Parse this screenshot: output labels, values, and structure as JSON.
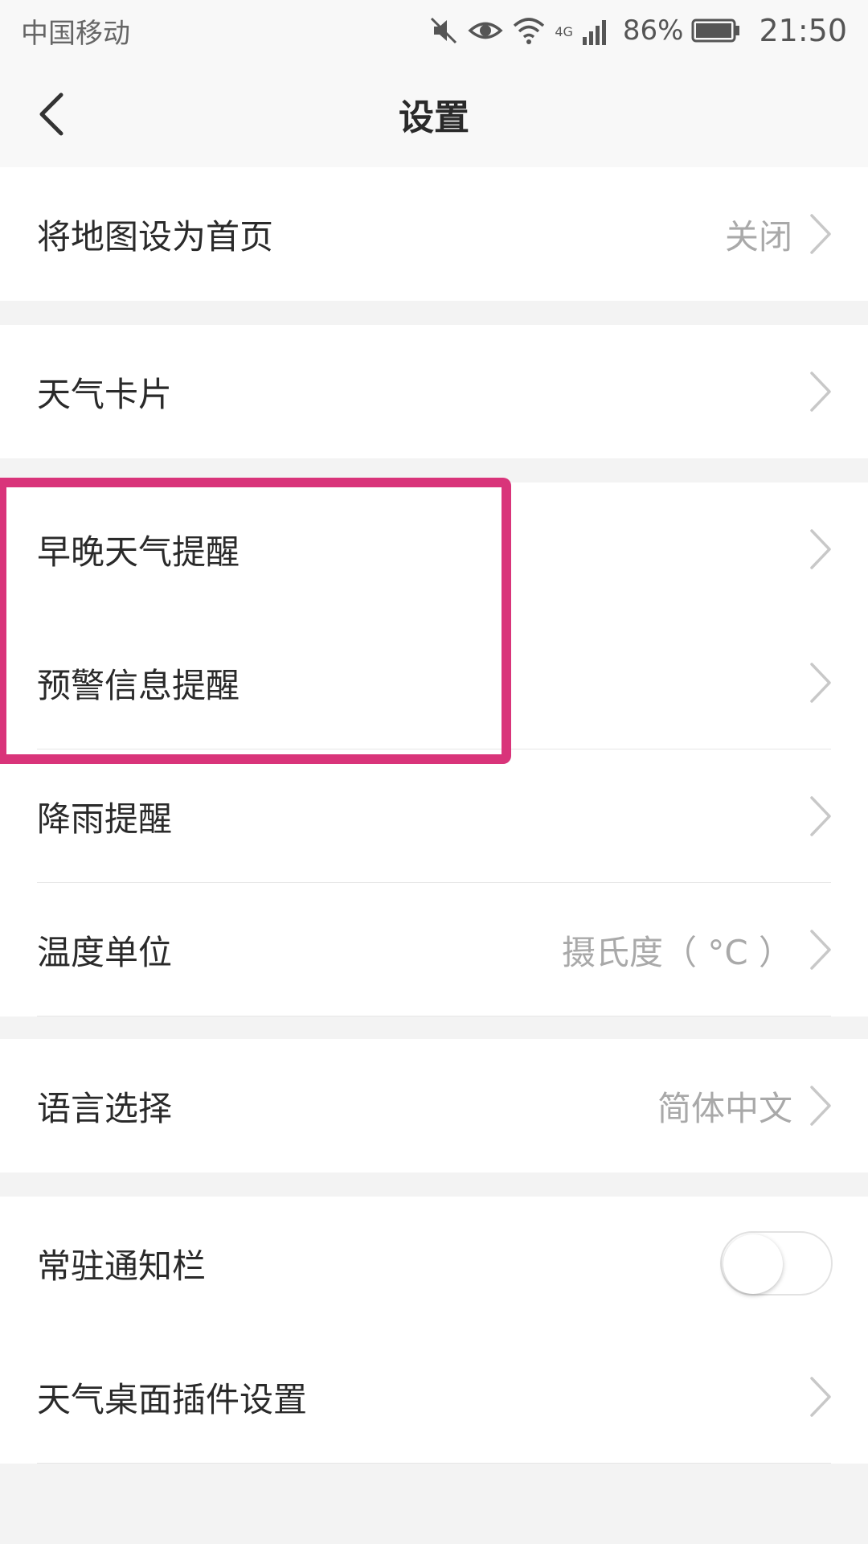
{
  "status_bar": {
    "carrier": "中国移动",
    "network": "4G",
    "battery": "86%",
    "time": "21:50"
  },
  "header": {
    "title": "设置"
  },
  "groups": {
    "home": {
      "label": "将地图设为首页",
      "value": "关闭"
    },
    "weather_card": {
      "label": "天气卡片"
    },
    "reminders": {
      "morning_evening": "早晚天气提醒",
      "warning": "预警信息提醒",
      "rain": "降雨提醒",
      "temperature_label": "温度单位",
      "temperature_value": "摄氏度（ °C ）"
    },
    "language": {
      "label": "语言选择",
      "value": "简体中文"
    },
    "notification": {
      "label": "常驻通知栏",
      "toggle_on": false,
      "widget_label": "天气桌面插件设置"
    }
  },
  "colors": {
    "highlight": "#d9347a",
    "chevron": "#c8c8c8"
  },
  "icons": [
    "back-arrow-icon",
    "mute-icon",
    "eye-icon",
    "wifi-icon",
    "signal-icon",
    "battery-icon",
    "chevron-right-icon"
  ]
}
